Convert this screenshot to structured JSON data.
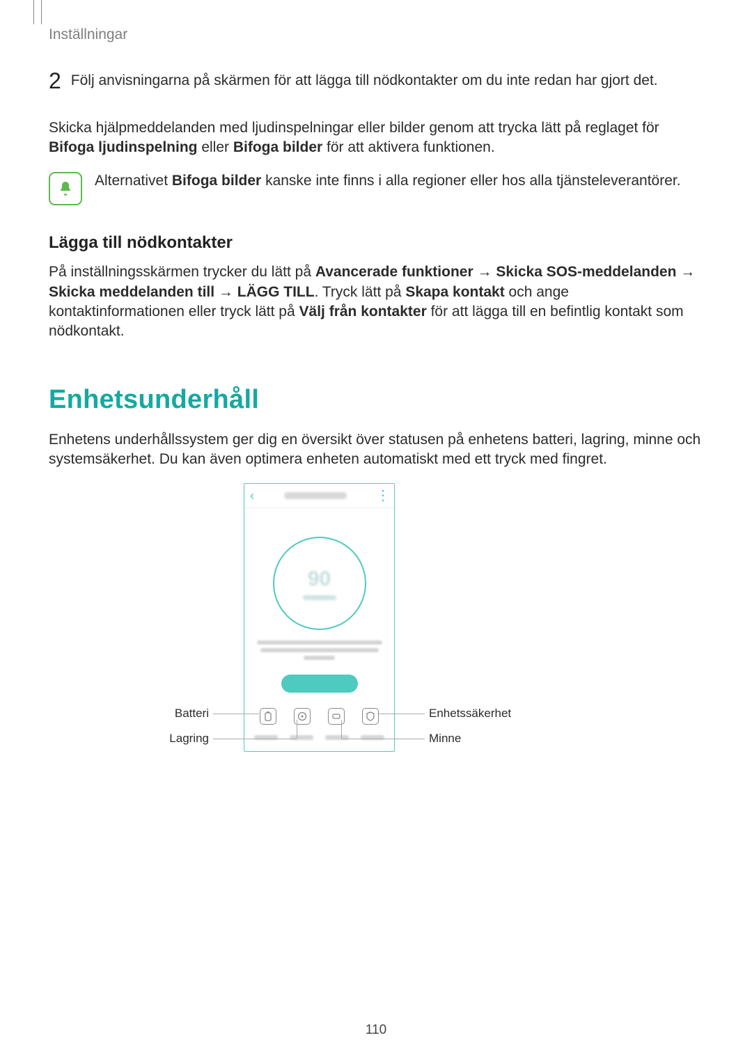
{
  "header": "Inställningar",
  "step2": {
    "num": "2",
    "text": "Följ anvisningarna på skärmen för att lägga till nödkontakter om du inte redan har gjort det."
  },
  "para1": {
    "pre": "Skicka hjälpmeddelanden med ljudinspelningar eller bilder genom att trycka lätt på reglaget för ",
    "b1": "Bifoga ljudinspelning",
    "mid1": " eller ",
    "b2": "Bifoga bilder",
    "post": " för att aktivera funktionen."
  },
  "note": {
    "pre": "Alternativet ",
    "b": "Bifoga bilder",
    "post": " kanske inte finns i alla regioner eller hos alla tjänsteleverantörer."
  },
  "h3": "Lägga till nödkontakter",
  "para2": {
    "t1": "På inställningsskärmen trycker du lätt på ",
    "b1": "Avancerade funktioner",
    "arrow1": " → ",
    "b2": "Skicka SOS-meddelanden",
    "arrow2": " → ",
    "b3": "Skicka meddelanden till",
    "arrow3": " → ",
    "b4": "LÄGG TILL",
    "t2": ". Tryck lätt på ",
    "b5": "Skapa kontakt",
    "t3": " och ange kontaktinformationen eller tryck lätt på ",
    "b6": "Välj från kontakter",
    "t4": " för att lägga till en befintlig kontakt som nödkontakt."
  },
  "h2": "Enhetsunderhåll",
  "para3": "Enhetens underhållssystem ger dig en översikt över statusen på enhetens batteri, lagring, minne och systemsäkerhet. Du kan även optimera enheten automatiskt med ett tryck med fingret.",
  "labels": {
    "battery": "Batteri",
    "storage": "Lagring",
    "security": "Enhetssäkerhet",
    "memory": "Minne"
  },
  "phone": {
    "score": "90"
  },
  "page_number": "110"
}
